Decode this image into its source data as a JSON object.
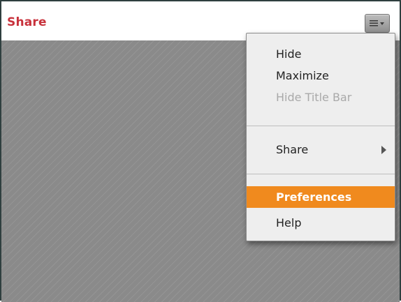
{
  "pod": {
    "title": "Share",
    "menu_button_icon": "menu-lines-dropdown-icon"
  },
  "menu": {
    "items": [
      {
        "label": "Hide",
        "enabled": true
      },
      {
        "label": "Maximize",
        "enabled": true
      },
      {
        "label": "Hide Title Bar",
        "enabled": false
      },
      {
        "label": "Share",
        "enabled": true,
        "has_submenu": true
      },
      {
        "label": "Preferences",
        "enabled": true,
        "highlighted": true
      },
      {
        "label": "Help",
        "enabled": true
      }
    ]
  },
  "colors": {
    "title": "#c8323c",
    "highlight": "#f08a1e",
    "content_bg": "#8a8a8a",
    "menu_bg": "#eeeeee"
  }
}
